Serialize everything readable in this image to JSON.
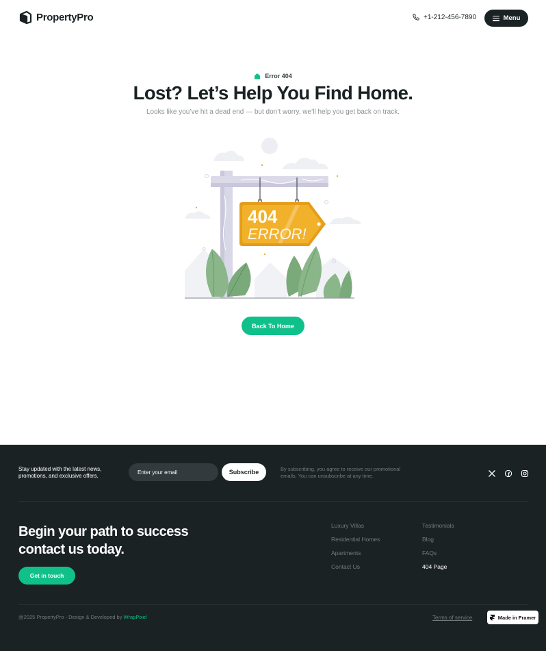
{
  "header": {
    "logo_text": "PropertyPro",
    "phone": "+1-212-456-7890",
    "menu_label": "Menu"
  },
  "hero": {
    "eyebrow": "Error 404",
    "title": "Lost? Let’s Help You Find Home.",
    "subtitle": "Looks like you’ve hit a dead end — but don’t worry, we’ll help you get back on track.",
    "sign_line1": "404",
    "sign_line2": "ERROR!",
    "back_button": "Back To Home"
  },
  "colors": {
    "accent": "#10c08a",
    "dark": "#1b2224",
    "sign": "#f2b12b"
  },
  "footer": {
    "newsletter_text": "Stay updated with the latest news, promotions, and exclusive offers.",
    "email_placeholder": "Enter your email",
    "subscribe_label": "Subscribe",
    "consent_text": "By subscribing, you agree to receive our promotional emails. You can unsubscribe  at any time.",
    "socials": [
      "x-icon",
      "facebook-icon",
      "instagram-icon"
    ],
    "cta_title": "Begin your path to  success contact us today.",
    "cta_button": "Get in touch",
    "links_col1": [
      "Luxury Villas",
      "Residential Homes",
      "Apartments",
      "Contact Us"
    ],
    "links_col2": [
      "Testimonials",
      "Blog",
      "FAQs",
      "404 Page"
    ],
    "copyright_prefix": "@2025 PropertyPro - Design & Developed by ",
    "copyright_brand": "WrapPixel",
    "terms": "Terms of service",
    "framer_badge": "Made in Framer"
  }
}
